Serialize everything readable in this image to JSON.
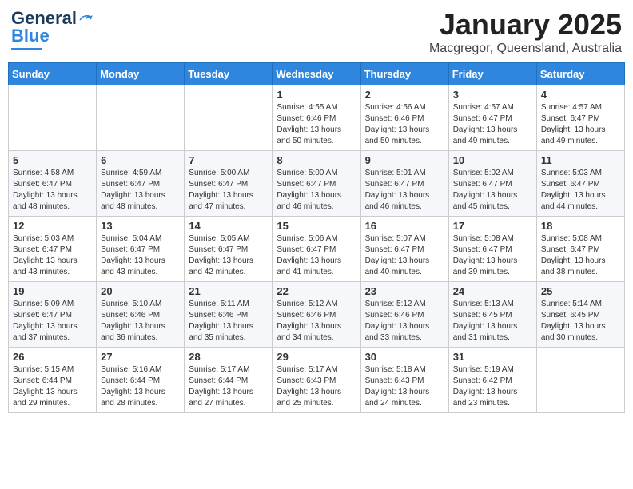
{
  "header": {
    "logo_general": "General",
    "logo_blue": "Blue",
    "month": "January 2025",
    "location": "Macgregor, Queensland, Australia"
  },
  "days_of_week": [
    "Sunday",
    "Monday",
    "Tuesday",
    "Wednesday",
    "Thursday",
    "Friday",
    "Saturday"
  ],
  "weeks": [
    [
      {
        "day": "",
        "info": ""
      },
      {
        "day": "",
        "info": ""
      },
      {
        "day": "",
        "info": ""
      },
      {
        "day": "1",
        "info": "Sunrise: 4:55 AM\nSunset: 6:46 PM\nDaylight: 13 hours\nand 50 minutes."
      },
      {
        "day": "2",
        "info": "Sunrise: 4:56 AM\nSunset: 6:46 PM\nDaylight: 13 hours\nand 50 minutes."
      },
      {
        "day": "3",
        "info": "Sunrise: 4:57 AM\nSunset: 6:47 PM\nDaylight: 13 hours\nand 49 minutes."
      },
      {
        "day": "4",
        "info": "Sunrise: 4:57 AM\nSunset: 6:47 PM\nDaylight: 13 hours\nand 49 minutes."
      }
    ],
    [
      {
        "day": "5",
        "info": "Sunrise: 4:58 AM\nSunset: 6:47 PM\nDaylight: 13 hours\nand 48 minutes."
      },
      {
        "day": "6",
        "info": "Sunrise: 4:59 AM\nSunset: 6:47 PM\nDaylight: 13 hours\nand 48 minutes."
      },
      {
        "day": "7",
        "info": "Sunrise: 5:00 AM\nSunset: 6:47 PM\nDaylight: 13 hours\nand 47 minutes."
      },
      {
        "day": "8",
        "info": "Sunrise: 5:00 AM\nSunset: 6:47 PM\nDaylight: 13 hours\nand 46 minutes."
      },
      {
        "day": "9",
        "info": "Sunrise: 5:01 AM\nSunset: 6:47 PM\nDaylight: 13 hours\nand 46 minutes."
      },
      {
        "day": "10",
        "info": "Sunrise: 5:02 AM\nSunset: 6:47 PM\nDaylight: 13 hours\nand 45 minutes."
      },
      {
        "day": "11",
        "info": "Sunrise: 5:03 AM\nSunset: 6:47 PM\nDaylight: 13 hours\nand 44 minutes."
      }
    ],
    [
      {
        "day": "12",
        "info": "Sunrise: 5:03 AM\nSunset: 6:47 PM\nDaylight: 13 hours\nand 43 minutes."
      },
      {
        "day": "13",
        "info": "Sunrise: 5:04 AM\nSunset: 6:47 PM\nDaylight: 13 hours\nand 43 minutes."
      },
      {
        "day": "14",
        "info": "Sunrise: 5:05 AM\nSunset: 6:47 PM\nDaylight: 13 hours\nand 42 minutes."
      },
      {
        "day": "15",
        "info": "Sunrise: 5:06 AM\nSunset: 6:47 PM\nDaylight: 13 hours\nand 41 minutes."
      },
      {
        "day": "16",
        "info": "Sunrise: 5:07 AM\nSunset: 6:47 PM\nDaylight: 13 hours\nand 40 minutes."
      },
      {
        "day": "17",
        "info": "Sunrise: 5:08 AM\nSunset: 6:47 PM\nDaylight: 13 hours\nand 39 minutes."
      },
      {
        "day": "18",
        "info": "Sunrise: 5:08 AM\nSunset: 6:47 PM\nDaylight: 13 hours\nand 38 minutes."
      }
    ],
    [
      {
        "day": "19",
        "info": "Sunrise: 5:09 AM\nSunset: 6:47 PM\nDaylight: 13 hours\nand 37 minutes."
      },
      {
        "day": "20",
        "info": "Sunrise: 5:10 AM\nSunset: 6:46 PM\nDaylight: 13 hours\nand 36 minutes."
      },
      {
        "day": "21",
        "info": "Sunrise: 5:11 AM\nSunset: 6:46 PM\nDaylight: 13 hours\nand 35 minutes."
      },
      {
        "day": "22",
        "info": "Sunrise: 5:12 AM\nSunset: 6:46 PM\nDaylight: 13 hours\nand 34 minutes."
      },
      {
        "day": "23",
        "info": "Sunrise: 5:12 AM\nSunset: 6:46 PM\nDaylight: 13 hours\nand 33 minutes."
      },
      {
        "day": "24",
        "info": "Sunrise: 5:13 AM\nSunset: 6:45 PM\nDaylight: 13 hours\nand 31 minutes."
      },
      {
        "day": "25",
        "info": "Sunrise: 5:14 AM\nSunset: 6:45 PM\nDaylight: 13 hours\nand 30 minutes."
      }
    ],
    [
      {
        "day": "26",
        "info": "Sunrise: 5:15 AM\nSunset: 6:44 PM\nDaylight: 13 hours\nand 29 minutes."
      },
      {
        "day": "27",
        "info": "Sunrise: 5:16 AM\nSunset: 6:44 PM\nDaylight: 13 hours\nand 28 minutes."
      },
      {
        "day": "28",
        "info": "Sunrise: 5:17 AM\nSunset: 6:44 PM\nDaylight: 13 hours\nand 27 minutes."
      },
      {
        "day": "29",
        "info": "Sunrise: 5:17 AM\nSunset: 6:43 PM\nDaylight: 13 hours\nand 25 minutes."
      },
      {
        "day": "30",
        "info": "Sunrise: 5:18 AM\nSunset: 6:43 PM\nDaylight: 13 hours\nand 24 minutes."
      },
      {
        "day": "31",
        "info": "Sunrise: 5:19 AM\nSunset: 6:42 PM\nDaylight: 13 hours\nand 23 minutes."
      },
      {
        "day": "",
        "info": ""
      }
    ]
  ]
}
